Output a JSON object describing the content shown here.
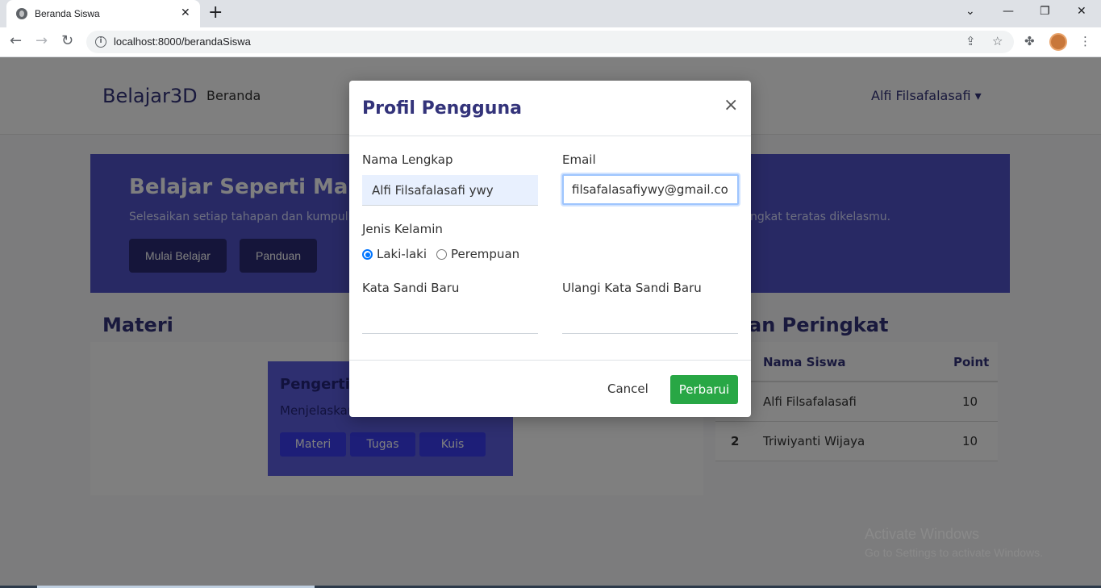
{
  "browser": {
    "tab_title": "Beranda Siswa",
    "tab_close": "✕",
    "new_tab": "+",
    "url": "localhost:8000/berandaSiswa",
    "info_icon": "i",
    "back": "←",
    "forward": "→",
    "reload": "↻",
    "minimize": "—",
    "restore": "❐",
    "close": "✕",
    "tab_search": "⌄",
    "share": "⇪",
    "star": "☆",
    "extensions": "✤",
    "menu": "⋮"
  },
  "navbar": {
    "brand": "Belajar3D",
    "link_home": "Beranda",
    "user": "Alfi Filsafalasafi",
    "caret": "▾"
  },
  "hero": {
    "title": "Belajar Seperti Main G",
    "subtitle_left": "Selesaikan setiap tahapan dan kumpulk",
    "subtitle_right": "ngkat teratas dikelasmu.",
    "btn_start": "Mulai Belajar",
    "btn_guide": "Panduan"
  },
  "materi": {
    "heading": "Materi",
    "card_title": "Pengertia",
    "card_desc": "Menjelaskan",
    "btn_materi": "Materi",
    "btn_tugas": "Tugas",
    "btn_kuis": "Kuis"
  },
  "ranking": {
    "heading": "an Peringkat",
    "col_name": "Nama Siswa",
    "col_point": "Point",
    "rows": [
      {
        "rank": "",
        "name": "Alfi Filsafalasafi",
        "point": "10"
      },
      {
        "rank": "2",
        "name": "Triwiyanti Wijaya",
        "point": "10"
      }
    ]
  },
  "watermark": {
    "line1": "Activate Windows",
    "line2": "Go to Settings to activate Windows."
  },
  "modal": {
    "title": "Profil Pengguna",
    "close": "×",
    "name_label": "Nama Lengkap",
    "name_value": "Alfi Filsafalasafi ywy",
    "email_label": "Email",
    "email_value": "filsafalasafiywy@gmail.com",
    "gender_label": "Jenis Kelamin",
    "gender_male": "Laki-laki",
    "gender_female": "Perempuan",
    "gender_selected": "Laki-laki",
    "new_password_label": "Kata Sandi Baru",
    "new_password_value": "",
    "repeat_password_label": "Ulangi Kata Sandi Baru",
    "repeat_password_value": "",
    "cancel": "Cancel",
    "update": "Perbarui"
  },
  "colors": {
    "primary": "#33337a",
    "hero_bg": "#5153c8",
    "success": "#28a745"
  }
}
